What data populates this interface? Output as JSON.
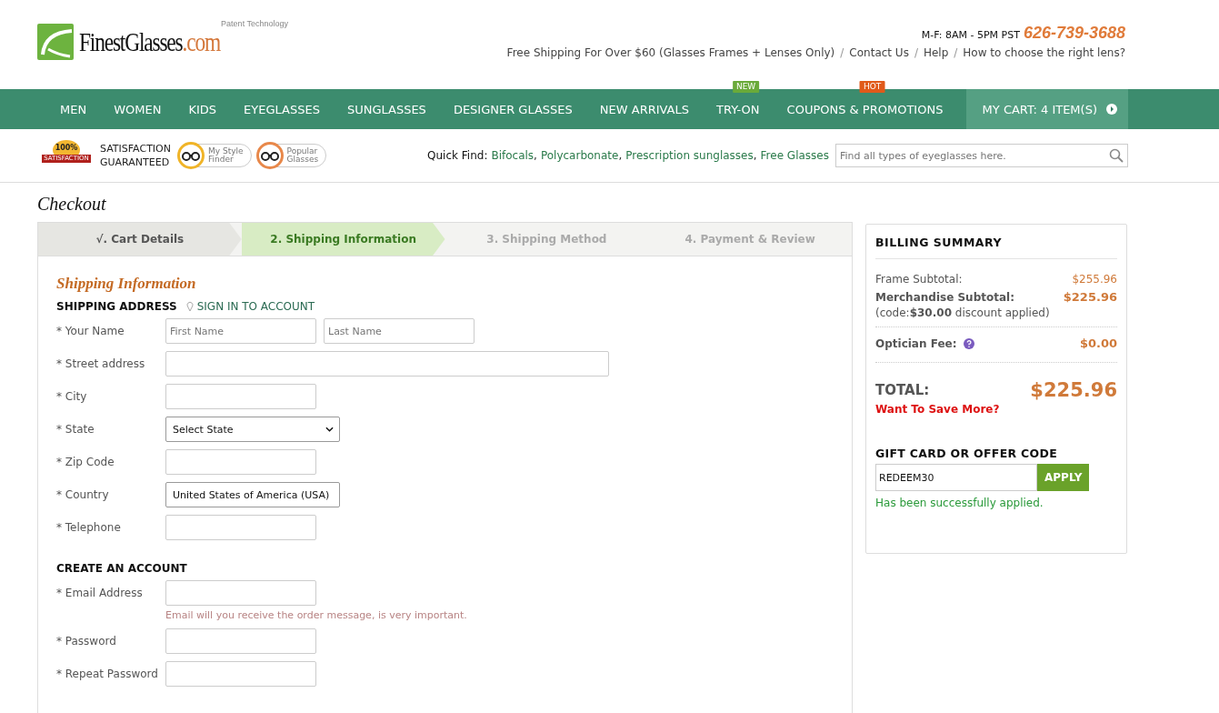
{
  "logo": {
    "name": "FinestGlasses",
    "tld": ".com",
    "tagline": "Patent Technology"
  },
  "header": {
    "hours": "M-F: 8AM - 5PM PST",
    "phone": "626-739-3688",
    "links": [
      {
        "label": "Free Shipping For Over $60 (Glasses Frames + Lenses Only)"
      },
      {
        "sep": "/",
        "label": "Contact Us"
      },
      {
        "sep": "/",
        "label": "Help"
      },
      {
        "sep": "/",
        "label": "How to choose the right lens?"
      }
    ]
  },
  "nav": {
    "items": [
      {
        "label": "MEN"
      },
      {
        "label": "WOMEN"
      },
      {
        "label": "KIDS"
      },
      {
        "label": "EYEGLASSES"
      },
      {
        "label": "SUNGLASSES"
      },
      {
        "label": "DESIGNER GLASSES"
      },
      {
        "label": "NEW ARRIVALS"
      },
      {
        "label": "TRY-ON",
        "badge": "NEW",
        "color": "#6aaa3a"
      },
      {
        "label": "COUPONS & PROMOTIONS",
        "badge": "HOT",
        "color": "#e05a1a"
      }
    ],
    "cart": "MY CART: 4 ITEM(S)"
  },
  "promo": {
    "badge_percent": "100%",
    "badge_ribbon": "SATISFACTION",
    "guarantee": [
      "SATISFACTION",
      "GUARANTEED"
    ],
    "pills": [
      {
        "label": [
          "My Style",
          "Finder"
        ],
        "color": "#f0b428"
      },
      {
        "label": [
          "Popular",
          "Glasses"
        ],
        "color": "#e8884a"
      }
    ]
  },
  "quick_find": {
    "label": "Quick Find:",
    "links": [
      {
        "label": "Bifocals",
        "sep": ","
      },
      {
        "label": "Polycarbonate",
        "sep": ","
      },
      {
        "label": "Prescription sunglasses",
        "sep": ","
      },
      {
        "label": "Free Glasses"
      }
    ],
    "search_placeholder": "Find all types of eyeglasses here."
  },
  "page_title": "Checkout",
  "steps": [
    {
      "label": "√. Cart Details",
      "selected": false,
      "done": true
    },
    {
      "label": "2. Shipping Information",
      "selected": true,
      "done": false
    },
    {
      "label": "3. Shipping Method",
      "selected": false,
      "done": false
    },
    {
      "label": "4. Payment & Review",
      "selected": false,
      "done": false
    }
  ],
  "form": {
    "title": "Shipping Information",
    "sections": [
      {
        "heading": "SHIPPING ADDRESS",
        "link": "SIGN IN TO ACCOUNT",
        "fields": [
          {
            "kind": "name",
            "label": "* Your Name",
            "placeholders": [
              "First Name",
              "Last Name"
            ]
          },
          {
            "kind": "wide",
            "label": "* Street address"
          },
          {
            "kind": "text",
            "label": "* City"
          },
          {
            "kind": "select",
            "label": "* State",
            "value": "Select State"
          },
          {
            "kind": "text",
            "label": "* Zip Code"
          },
          {
            "kind": "select",
            "label": "* Country",
            "value": "United States of America (USA)"
          },
          {
            "kind": "text",
            "label": "* Telephone"
          }
        ]
      },
      {
        "heading": "CREATE AN ACCOUNT",
        "fields": [
          {
            "kind": "text",
            "label": "* Email Address",
            "hint": "Email will you receive the order message, is very important."
          },
          {
            "kind": "text",
            "label": "* Password"
          },
          {
            "kind": "text",
            "label": "* Repeat Password"
          }
        ]
      }
    ]
  },
  "billing": {
    "title": "BILLING SUMMARY",
    "frame_label": "Frame Subtotal:",
    "frame_value": "$255.96",
    "merch_label": "Merchandise Subtotal:",
    "merch_value": "$225.96",
    "discount": "(code:**$30.00** discount applied)",
    "fee_label": "Optician Fee:",
    "fee_value": "$0.00",
    "total_label": "TOTAL:",
    "total_value": "$225.96",
    "save_more": "Want To Save More?",
    "code_title": "GIFT CARD OR OFFER CODE",
    "code_value": "REDEEM30",
    "apply": "APPLY",
    "success": "Has been successfully applied."
  }
}
